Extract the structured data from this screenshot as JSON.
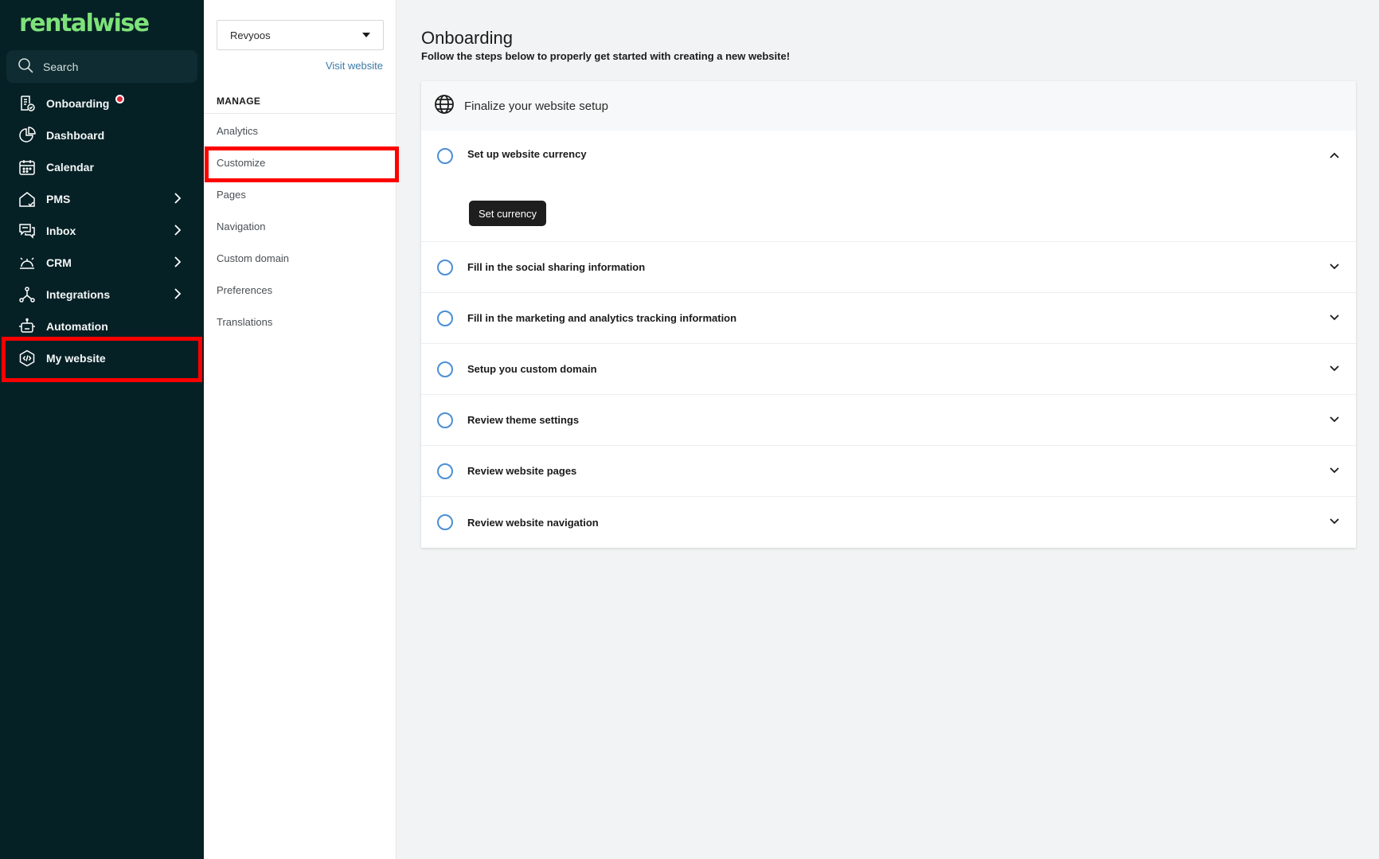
{
  "sidebar": {
    "logo": "rentalwise",
    "search_label": "Search",
    "items": [
      {
        "label": "Onboarding"
      },
      {
        "label": "Dashboard"
      },
      {
        "label": "Calendar"
      },
      {
        "label": "PMS"
      },
      {
        "label": "Inbox"
      },
      {
        "label": "CRM"
      },
      {
        "label": "Integrations"
      },
      {
        "label": "Automation"
      },
      {
        "label": "My website"
      }
    ]
  },
  "panel": {
    "site_selected": "Revyoos",
    "visit_label": "Visit website",
    "section_label": "MANAGE",
    "items": [
      {
        "label": "Analytics"
      },
      {
        "label": "Customize"
      },
      {
        "label": "Pages"
      },
      {
        "label": "Navigation"
      },
      {
        "label": "Custom domain"
      },
      {
        "label": "Preferences"
      },
      {
        "label": "Translations"
      }
    ]
  },
  "main": {
    "title": "Onboarding",
    "subtitle": "Follow the steps below to properly get started with creating a new website!",
    "card_title": "Finalize your website setup",
    "steps": [
      {
        "label": "Set up website currency",
        "button": "Set currency"
      },
      {
        "label": "Fill in the social sharing information"
      },
      {
        "label": "Fill in the marketing and analytics tracking information"
      },
      {
        "label": "Setup you custom domain"
      },
      {
        "label": "Review theme settings"
      },
      {
        "label": "Review website pages"
      },
      {
        "label": "Review website navigation"
      }
    ]
  },
  "colors": {
    "sidebar_bg": "#062126",
    "logo_green": "#7ee27a",
    "highlight_red": "#ff0000",
    "link_blue": "#3b7aa8",
    "step_circle": "#4b8fd4",
    "notification_red": "#e3253a"
  },
  "icons": {
    "search": "search-icon",
    "onboarding": "onboarding-icon",
    "dashboard": "dashboard-icon",
    "calendar": "calendar-icon",
    "pms": "home-icon",
    "inbox": "inbox-icon",
    "crm": "crm-icon",
    "integrations": "integrations-icon",
    "automation": "robot-icon",
    "my_website": "website-code-icon",
    "globe": "globe-icon"
  }
}
